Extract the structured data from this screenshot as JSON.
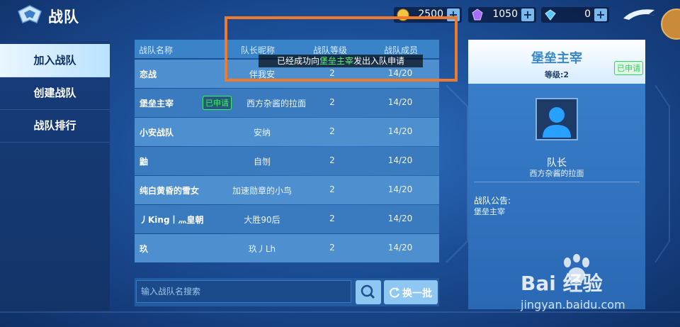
{
  "header": {
    "title": "战队",
    "back_label": ""
  },
  "resources": [
    {
      "name": "gold",
      "value": "2500",
      "icon": "gold-coin-icon",
      "color": "#f5c542"
    },
    {
      "name": "crystal",
      "value": "1050",
      "icon": "purple-crystal-icon",
      "color": "#a66bff"
    },
    {
      "name": "diamond",
      "value": "0",
      "icon": "diamond-icon",
      "color": "#59c8ff"
    }
  ],
  "sidebar": {
    "items": [
      {
        "label": "加入战队",
        "active": true
      },
      {
        "label": "创建战队",
        "active": false
      },
      {
        "label": "战队排行",
        "active": false
      }
    ]
  },
  "list": {
    "columns": [
      "战队名称",
      "队长昵称",
      "战队等级",
      "战队成员"
    ],
    "rows": [
      {
        "name": "恋战",
        "leader": "伴我安",
        "level": "2",
        "members": "14/20",
        "badge": ""
      },
      {
        "name": "堡垒主宰",
        "leader": "西方杂酱的拉面",
        "level": "2",
        "members": "14/20",
        "badge": "已申请"
      },
      {
        "name": "小安战队",
        "leader": "安纳",
        "level": "2",
        "members": "14/20",
        "badge": ""
      },
      {
        "name": "鼬",
        "leader": "自刎",
        "level": "2",
        "members": "14/20",
        "badge": ""
      },
      {
        "name": "纯白黄昏的雪女",
        "leader": "加速勋章的小鸟",
        "level": "2",
        "members": "14/20",
        "badge": ""
      },
      {
        "name": "丿King丨灬皇朝",
        "leader": "大胜90后",
        "level": "2",
        "members": "14/20",
        "badge": ""
      },
      {
        "name": "玖",
        "leader": "玖丿Lh",
        "level": "2",
        "members": "14/20",
        "badge": ""
      }
    ]
  },
  "search": {
    "placeholder": "输入战队名搜索",
    "refresh_label": "换一批"
  },
  "toast": {
    "prefix": "已经成功向",
    "team": "堡垒主宰",
    "suffix": "发出入队申请"
  },
  "panel": {
    "team_name": "堡垒主宰",
    "level": "等级:2",
    "badge": "已申请",
    "leader_role": "队长",
    "leader_name": "西方杂酱的拉面",
    "notice_label": "战队公告:",
    "notice_text": "堡垒主宰"
  },
  "watermark": {
    "main": "Bai 经验",
    "sub": "jingyan.baidu.com"
  },
  "colors": {
    "annotation": "#f07a2a",
    "accent": "#3cf06a"
  }
}
